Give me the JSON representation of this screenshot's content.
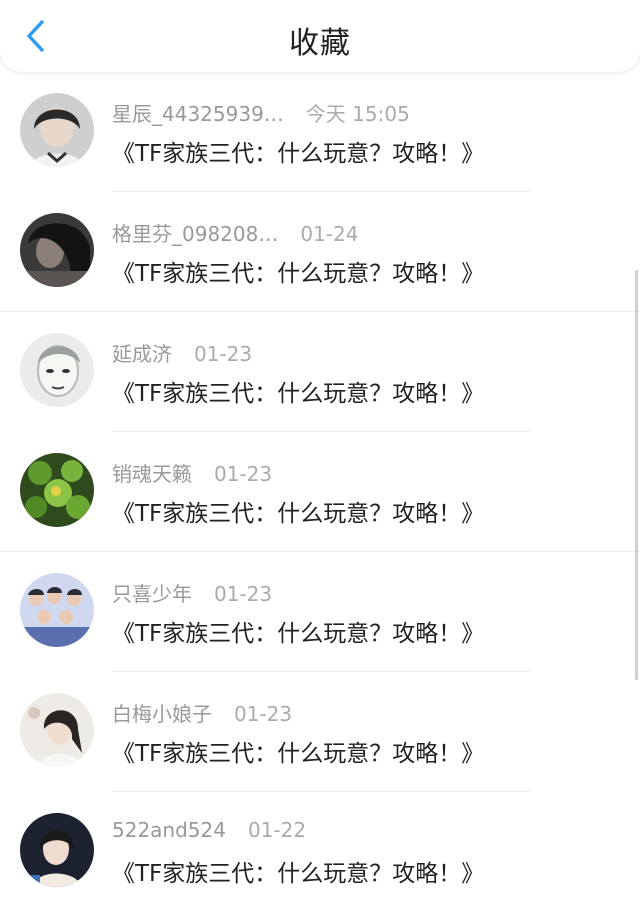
{
  "header": {
    "title": "收藏",
    "back_icon": "chevron-left-icon",
    "accent": "#2d9cf0"
  },
  "favorites": [
    {
      "user": "星辰_44325939…",
      "time": "今天 15:05",
      "text": "《TF家族三代：什么玩意？攻略！》"
    },
    {
      "user": "格里芬_098208…",
      "time": "01-24",
      "text": "《TF家族三代：什么玩意？攻略！》"
    },
    {
      "user": "延成济",
      "time": "01-23",
      "text": "《TF家族三代：什么玩意？攻略！》"
    },
    {
      "user": "销魂天籁",
      "time": "01-23",
      "text": "《TF家族三代：什么玩意？攻略！》"
    },
    {
      "user": "只喜少年",
      "time": "01-23",
      "text": "《TF家族三代：什么玩意？攻略！》"
    },
    {
      "user": "白梅小娘子",
      "time": "01-23",
      "text": "《TF家族三代：什么玩意？攻略！》"
    },
    {
      "user": "522and524",
      "time": "01-22",
      "text": "《TF家族三代：什么玩意？攻略！》"
    }
  ]
}
